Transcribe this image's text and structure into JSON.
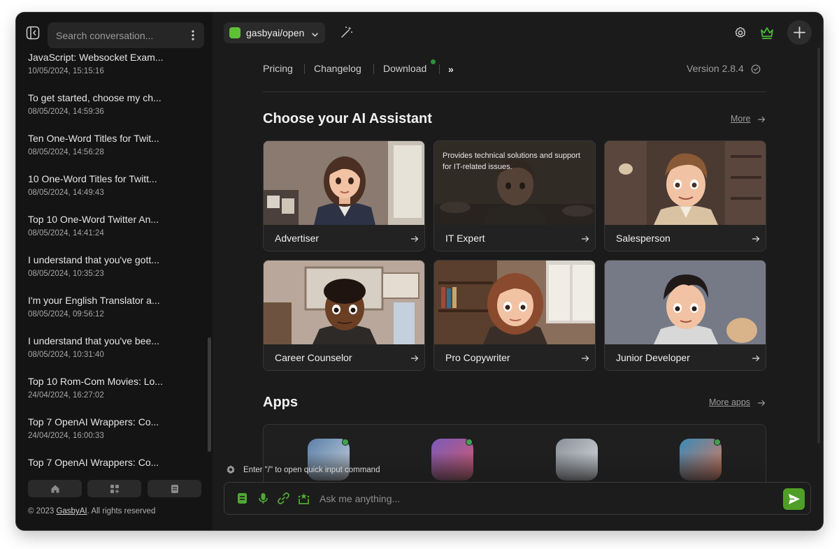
{
  "sidebar": {
    "search_placeholder": "Search conversation...",
    "conversations": [
      {
        "title": "JavaScript: Websocket Exam...",
        "date": "10/05/2024, 15:15:16"
      },
      {
        "title": "To get started, choose my ch...",
        "date": "08/05/2024, 14:59:36"
      },
      {
        "title": "Ten One-Word Titles for Twit...",
        "date": "08/05/2024, 14:56:28"
      },
      {
        "title": "10 One-Word Titles for Twitt...",
        "date": "08/05/2024, 14:49:43"
      },
      {
        "title": "Top 10 One-Word Twitter An...",
        "date": "08/05/2024, 14:41:24"
      },
      {
        "title": "I understand that you've gott...",
        "date": "08/05/2024, 10:35:23"
      },
      {
        "title": "I'm your English Translator a...",
        "date": "08/05/2024, 09:56:12"
      },
      {
        "title": "I understand that you've bee...",
        "date": "08/05/2024, 10:31:40"
      },
      {
        "title": "Top 10 Rom-Com Movies: Lo...",
        "date": "24/04/2024, 16:27:02"
      },
      {
        "title": "Top 7 OpenAI Wrappers: Co...",
        "date": "24/04/2024, 16:00:33"
      },
      {
        "title": "Top 7 OpenAI Wrappers: Co...",
        "date": ""
      }
    ],
    "copyright_prefix": "© 2023 ",
    "copyright_brand": "GasbyAI",
    "copyright_suffix": ". All rights reserved"
  },
  "header": {
    "model": "gasbyai/open"
  },
  "nav": {
    "pricing": "Pricing",
    "changelog": "Changelog",
    "download": "Download",
    "more": "»",
    "version": "Version 2.8.4"
  },
  "assistants": {
    "title": "Choose your AI Assistant",
    "more": "More",
    "cards": [
      {
        "name": "Advertiser",
        "description": ""
      },
      {
        "name": "IT Expert",
        "description": "Provides technical solutions and support for IT-related issues."
      },
      {
        "name": "Salesperson",
        "description": ""
      },
      {
        "name": "Career Counselor",
        "description": ""
      },
      {
        "name": "Pro Copywriter",
        "description": ""
      },
      {
        "name": "Junior Developer",
        "description": ""
      }
    ]
  },
  "apps": {
    "title": "Apps",
    "more": "More apps"
  },
  "composer": {
    "hint": "Enter \"/\" to open quick input command",
    "placeholder": "Ask me anything..."
  },
  "colors": {
    "accent": "#4f9e25",
    "model_dot": "#5cc133",
    "background": "#1b1b1b",
    "sidebar": "#141414"
  }
}
